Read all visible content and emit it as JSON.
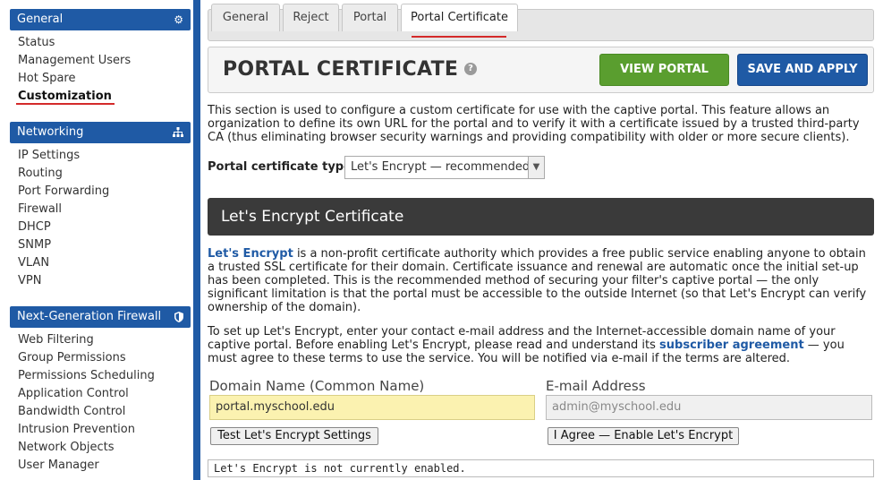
{
  "sidebar": {
    "general": {
      "title": "General",
      "icon": "gear-icon",
      "items": [
        "Status",
        "Management Users",
        "Hot Spare",
        "Customization"
      ]
    },
    "networking": {
      "title": "Networking",
      "icon": "network-icon",
      "items": [
        "IP Settings",
        "Routing",
        "Port Forwarding",
        "Firewall",
        "DHCP",
        "SNMP",
        "VLAN",
        "VPN"
      ]
    },
    "ngfw": {
      "title": "Next-Generation Firewall",
      "icon": "shield-icon",
      "items": [
        "Web Filtering",
        "Group Permissions",
        "Permissions Scheduling",
        "Application Control",
        "Bandwidth Control",
        "Intrusion Prevention",
        "Network Objects",
        "User Manager"
      ]
    }
  },
  "tabs": [
    "General",
    "Reject",
    "Portal",
    "Portal Certificate"
  ],
  "header": {
    "title": "PORTAL CERTIFICATE",
    "view_portal": "VIEW PORTAL",
    "save_apply": "SAVE AND APPLY"
  },
  "intro": "This section is used to configure a custom certificate for use with the captive portal. This feature allows an organization to define its own URL for the portal and to verify it with a certificate issued by a trusted third-party CA (thus eliminating browser security warnings and providing compatibility with older or more secure clients).",
  "cert_type": {
    "label": "Portal certificate type:",
    "selected": "Let's Encrypt — recommended"
  },
  "le_section": {
    "title": "Let's Encrypt Certificate",
    "desc_link": "Let's Encrypt",
    "desc_rest": " is a non-profit certificate authority which provides a free public service enabling anyone to obtain a trusted SSL certificate for their domain. Certificate issuance and renewal are automatic once the initial set-up has been completed. This is the recommended method of securing your filter's captive portal — the only significant limitation is that the portal must be accessible to the outside Internet (so that Let's Encrypt can verify ownership of the domain).",
    "setup_pre": "To set up Let's Encrypt, enter your contact e-mail address and the Internet-accessible domain name of your captive portal. Before enabling Let's Encrypt, please read and understand its ",
    "setup_link": "subscriber agreement",
    "setup_post": " — you must agree to these terms to use the service. You will be notified via e-mail if the terms are altered.",
    "domain_label": "Domain Name (Common Name)",
    "domain_value": "portal.myschool.edu",
    "email_label": "E-mail Address",
    "email_placeholder": "admin@myschool.edu",
    "test_button": "Test Let's Encrypt Settings",
    "agree_button": "I Agree — Enable Let's Encrypt",
    "status": "Let's Encrypt is not currently enabled."
  },
  "colors": {
    "brand_blue": "#1f5aa5",
    "green_button": "#5a9e2f",
    "active_underline": "#d42a2a"
  }
}
